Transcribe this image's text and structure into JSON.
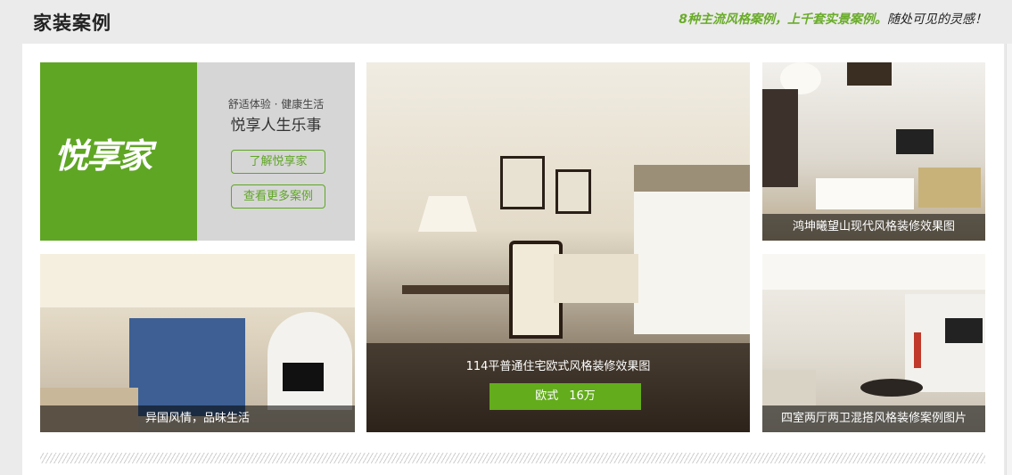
{
  "header": {
    "title": "家装案例",
    "tagline_highlight": "8种主流风格案例，上千套实景案例。",
    "tagline_rest": "随处可见的灵感！"
  },
  "brand": {
    "logo_text": "悦享家",
    "subtitle": "舒适体验 · 健康生活",
    "slogan": "悦享人生乐事",
    "button_learn": "了解悦享家",
    "button_more": "查看更多案例",
    "accent_color": "#5fa624"
  },
  "cases": {
    "left_bottom": {
      "caption": "异国风情，品味生活"
    },
    "center": {
      "caption": "114平普通住宅欧式风格装修效果图",
      "style": "欧式",
      "price": "16万"
    },
    "right_top": {
      "caption": "鸿坤曦望山现代风格装修效果图"
    },
    "right_bottom": {
      "caption": "四室两厅两卫混搭风格装修案例图片"
    }
  }
}
